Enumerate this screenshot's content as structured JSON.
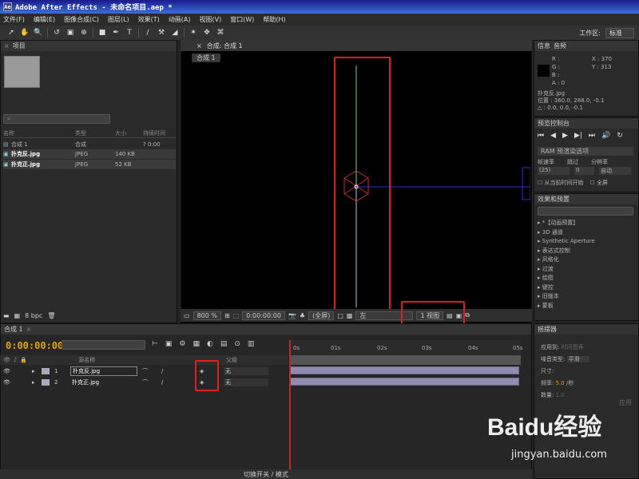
{
  "app": {
    "title": "Adobe After Effects - 未命名项目.aep *"
  },
  "menu": [
    "文件(F)",
    "编辑(E)",
    "图像合成(C)",
    "图层(L)",
    "效果(T)",
    "动画(A)",
    "视图(V)",
    "窗口(W)",
    "帮助(H)"
  ],
  "toolbar": {
    "workspace_label": "工作区:",
    "workspace_value": "标准"
  },
  "project": {
    "tab": "项目",
    "search_placeholder": "",
    "columns": [
      "名称",
      "类型",
      "大小",
      "持续时间"
    ],
    "rows": [
      {
        "name": "合成 1",
        "type": "合成",
        "size": "",
        "duration": "? 0:00"
      },
      {
        "name": "扑克反.jpg",
        "type": "JPEG",
        "size": "140 KB",
        "duration": ""
      },
      {
        "name": "扑克正.jpg",
        "type": "JPEG",
        "size": "52 KB",
        "duration": ""
      }
    ],
    "bpc": "8 bpc"
  },
  "composition": {
    "tab": "合成: 合成 1",
    "crumb": "合成 1",
    "zoom": "800 %",
    "timecode": "0:00:00:00",
    "resolution": "(全屏)",
    "view": "左",
    "views": "1 视图"
  },
  "info": {
    "tabs": [
      "信息",
      "音频"
    ],
    "r": "R :",
    "g": "G :",
    "b": "B :",
    "a": "A : 0",
    "x": "X : 370",
    "y": "Y : 313",
    "name": "扑克反.jpg",
    "position": "位置 : 360.0, 288.0, -0.1",
    "delta": "△ : 0.0, 0.0, -0.1"
  },
  "preview": {
    "tab": "预览控制台",
    "ram": "RAM 预渲染选项",
    "labels": [
      "帧速率",
      "跳过",
      "分辨率"
    ],
    "values": [
      "(25)",
      "0",
      "自动"
    ],
    "from_current": "从当前时间开始",
    "fullscreen": "全屏"
  },
  "effects": {
    "tab": "效果和预置",
    "search": "",
    "items": [
      "*【动画预置】",
      "3D 通道",
      "Synthetic Aperture",
      "表达式控制",
      "风格化",
      "过渡",
      "绘图",
      "键控",
      "旧版本",
      "蒙板"
    ]
  },
  "wiggler": {
    "tab": "摇摆器",
    "apply_to": "应用到:",
    "apply_val": "时间图表",
    "noise": "噪音类型:",
    "noise_val": "平滑",
    "dim": "尺寸:",
    "freq": "频率:",
    "freq_val": "5.0",
    "per_sec": "/秒",
    "amount": "数量:",
    "amount_val": "1.0",
    "apply_btn": "应用"
  },
  "timeline": {
    "tab": "合成 1",
    "timecode": "0:00:00:00",
    "col_source": "源名称",
    "col_parent": "父级",
    "layers": [
      {
        "num": "1",
        "name": "扑克反.jpg",
        "parent": "无"
      },
      {
        "num": "2",
        "name": "扑克正.jpg",
        "parent": "无"
      }
    ],
    "ruler": [
      "0s",
      "01s",
      "02s",
      "03s",
      "04s",
      "05s"
    ],
    "bottom": "切换开关 / 模式"
  },
  "watermark": {
    "brand": "Baidu经验",
    "url": "jingyan.baidu.com"
  }
}
